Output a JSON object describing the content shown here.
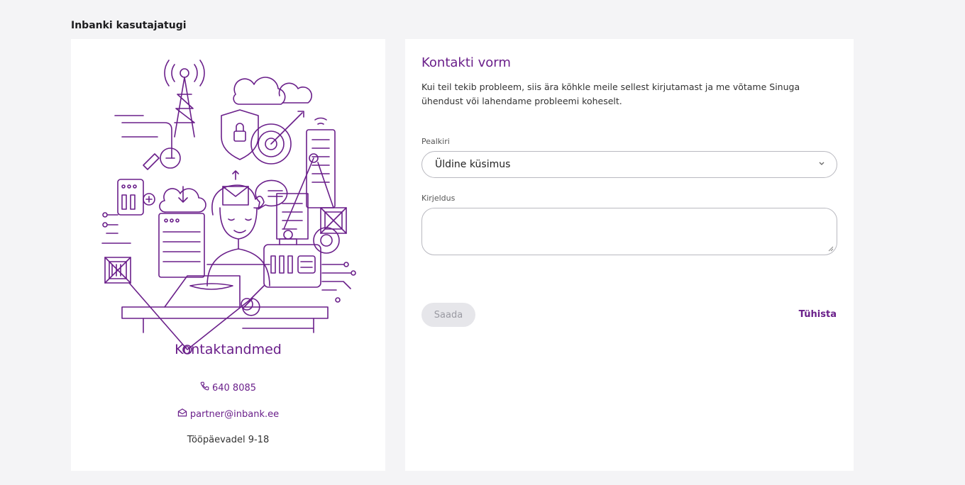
{
  "page": {
    "heading": "Inbanki kasutajatugi"
  },
  "contact": {
    "title": "Kontaktandmed",
    "phone": "640 8085",
    "email": "partner@inbank.ee",
    "hours": "Tööpäevadel 9-18",
    "phone_icon": "phone-icon",
    "email_icon": "envelope-icon"
  },
  "form": {
    "title": "Kontakti vorm",
    "description": "Kui teil tekib probleem, siis ära kõhkle meile sellest kirjutamast ja me võtame Sinuga ühendust või lahendame probleemi koheselt.",
    "subject_label": "Pealkiri",
    "subject_value": "Üldine küsimus",
    "description_label": "Kirjeldus",
    "description_value": "",
    "send_label": "Saada",
    "cancel_label": "Tühista"
  },
  "colors": {
    "brand": "#6a1f8a",
    "background": "#f4f4f6",
    "card": "#ffffff",
    "disabled_button": "#e6e6ea"
  }
}
